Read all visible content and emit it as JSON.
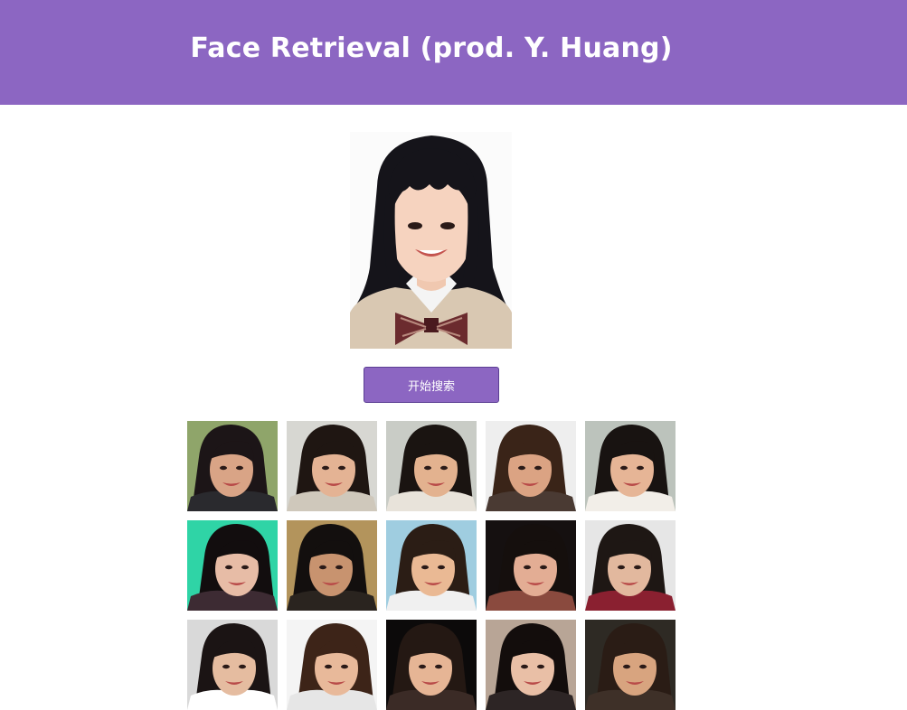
{
  "header": {
    "title": "Face Retrieval (prod. Y. Huang)",
    "background_color": "#8c66c2"
  },
  "query": {
    "image_kind": "portrait-photo",
    "background_color": "#f8f8f8"
  },
  "search_button": {
    "label": "开始搜索",
    "color": "#8c66c2"
  },
  "results": [
    {
      "bg": "#8fa56a",
      "hair": "#1c1517",
      "skin": "#d9a486",
      "cloth": "#2a2a2e"
    },
    {
      "bg": "#d7d7d2",
      "hair": "#1f1612",
      "skin": "#e4b394",
      "cloth": "#cfc8bb"
    },
    {
      "bg": "#c9ccc6",
      "hair": "#1a1411",
      "skin": "#e3b28f",
      "cloth": "#e8e3da"
    },
    {
      "bg": "#eeeeee",
      "hair": "#3a2418",
      "skin": "#dba383",
      "cloth": "#4a3a33"
    },
    {
      "bg": "#bcc3bc",
      "hair": "#181311",
      "skin": "#e6b596",
      "cloth": "#f2eee8"
    },
    {
      "bg": "#2fd4a6",
      "hair": "#120d0e",
      "skin": "#e7bca6",
      "cloth": "#3d2b33"
    },
    {
      "bg": "#b3945c",
      "hair": "#130f0e",
      "skin": "#c8936f",
      "cloth": "#2a241f"
    },
    {
      "bg": "#9fcde0",
      "hair": "#2b1d15",
      "skin": "#eab994",
      "cloth": "#f0f0f0"
    },
    {
      "bg": "#151010",
      "hair": "#150f0d",
      "skin": "#e3ad94",
      "cloth": "#8a4a3e"
    },
    {
      "bg": "#e6e6e6",
      "hair": "#1e1714",
      "skin": "#e2b89e",
      "cloth": "#8a2030"
    },
    {
      "bg": "#d9d9d9",
      "hair": "#1b1414",
      "skin": "#e5bca0",
      "cloth": "#ffffff"
    },
    {
      "bg": "#f4f4f4",
      "hair": "#3d2418",
      "skin": "#e8b99a",
      "cloth": "#e6e6e6"
    },
    {
      "bg": "#0c0a0a",
      "hair": "#241813",
      "skin": "#e6b595",
      "cloth": "#3b2b26"
    },
    {
      "bg": "#b8a596",
      "hair": "#130d0c",
      "skin": "#e9bfa6",
      "cloth": "#2d2525"
    },
    {
      "bg": "#2e2a24",
      "hair": "#2a1c15",
      "skin": "#d8a47f",
      "cloth": "#3e3028"
    }
  ]
}
